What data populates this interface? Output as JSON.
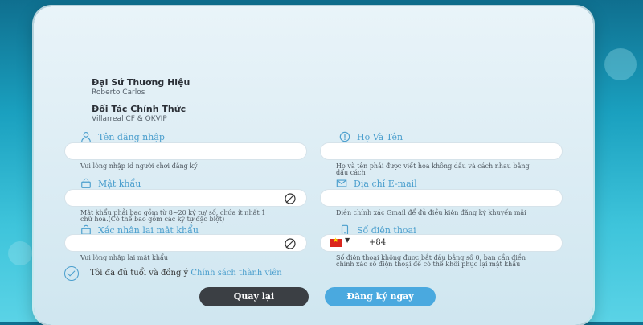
{
  "ambassador": {
    "title": "Đại Sứ Thương Hiệu",
    "name": "Roberto Carlos"
  },
  "partner": {
    "title": "Đối Tác Chính Thức",
    "name": "Villarreal CF & OKVIP"
  },
  "form": {
    "username": {
      "label": "Tên đăng nhập",
      "value": "",
      "hint": "Vui lòng nhập id người chơi đăng ký"
    },
    "fullname": {
      "label": "Họ Và Tên",
      "value": "",
      "hint_line1": "Họ và tên phải được viết hoa không dấu và cách nhau bằng",
      "hint_line2": "dấu cách"
    },
    "password": {
      "label": "Mật khẩu",
      "value": "",
      "hint_line1": "Mật khẩu phải bao gồm từ 8~20 ký tự/ số, chứa ít nhất 1",
      "hint_line2": "chữ hoa.(Có thể bao gồm các ký tự đặc biệt)"
    },
    "email": {
      "label": "Địa chỉ E-mail",
      "value": "",
      "hint": "Điền chính xác Gmail để đủ điều kiện đăng ký khuyến mãi"
    },
    "confirm_password": {
      "label": "Xác nhận lại mật khẩu",
      "value": "",
      "hint": "Vui lòng nhập lại mật khẩu"
    },
    "phone": {
      "label": "Số điện thoại",
      "code": "+84",
      "hint_line1": "Số điện thoại không được bắt đầu bằng số 0, bạn cần điền",
      "hint_line2": "chính xác số điện thoại để có thể khôi phục lại mật khẩu"
    },
    "agree_text": "Tôi đã đủ tuổi và đồng ý",
    "agree_link": "Chính sách thành viên"
  },
  "buttons": {
    "back": "Quay lại",
    "register": "Đăng ký ngay"
  },
  "colors": {
    "accent": "#4a9ecd",
    "button_dark": "#3b3f44",
    "button_blue": "#4aa9df"
  },
  "icons": [
    "user-icon",
    "info-icon",
    "lock-icon",
    "mail-icon",
    "phone-icon",
    "eye-off-icon",
    "checkbox-icon",
    "vn-flag-icon"
  ]
}
